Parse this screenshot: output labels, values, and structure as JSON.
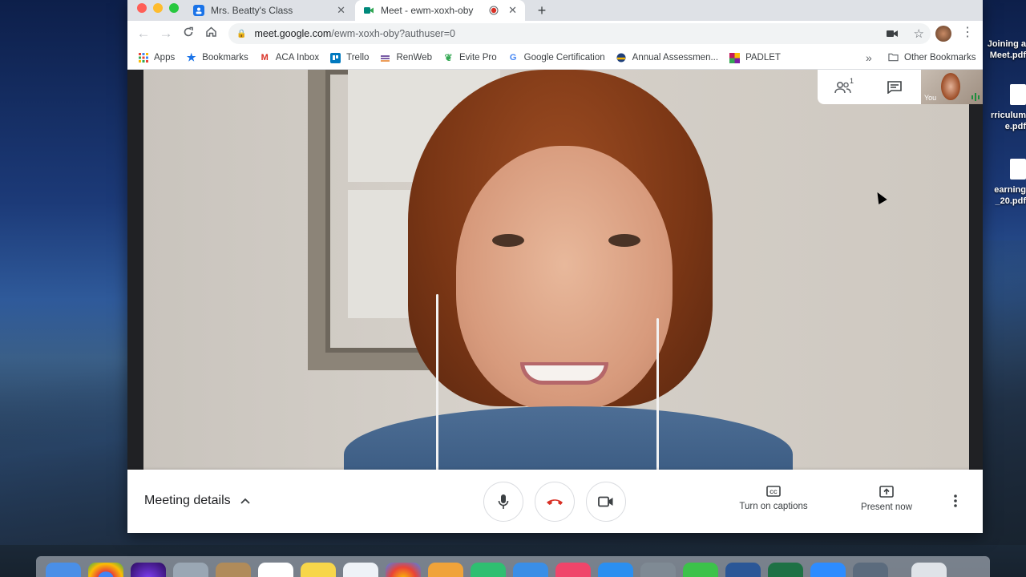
{
  "browser": {
    "tabs": [
      {
        "title": "Mrs. Beatty's Class",
        "active": false
      },
      {
        "title": "Meet - ewm-xoxh-oby",
        "active": true,
        "recording": true
      }
    ],
    "new_tab_symbol": "+",
    "url_host": "meet.google.com",
    "url_path": "/ewm-xoxh-oby?authuser=0",
    "bookmarks": [
      {
        "label": "Apps",
        "icon": "apps-grid-icon",
        "color": "#ea4335"
      },
      {
        "label": "Bookmarks",
        "icon": "star-icon",
        "color": "#1a73e8"
      },
      {
        "label": "ACA Inbox",
        "icon": "gmail-icon",
        "color": "#d93025"
      },
      {
        "label": "Trello",
        "icon": "trello-icon",
        "color": "#0079bf"
      },
      {
        "label": "RenWeb",
        "icon": "renweb-icon",
        "color": "#7b5ea7"
      },
      {
        "label": "Evite Pro",
        "icon": "evite-icon",
        "color": "#34a853"
      },
      {
        "label": "Google Certification",
        "icon": "google-icon",
        "color": "#4285f4"
      },
      {
        "label": "Annual Assessmen...",
        "icon": "assessment-icon",
        "color": "#f4b400"
      },
      {
        "label": "PADLET",
        "icon": "padlet-icon",
        "color": "#c2185b"
      }
    ],
    "overflow_symbol": "»",
    "other_bookmarks": "Other Bookmarks"
  },
  "meet": {
    "participants_count": "1",
    "self_label": "You",
    "meeting_details": "Meeting details",
    "captions_label": "Turn on captions",
    "present_label": "Present now",
    "end_call_color": "#d93025"
  },
  "desktop": {
    "files": [
      {
        "line1": "Joining a",
        "line2": "Meet.pdf"
      },
      {
        "line1": "rriculum",
        "line2": "e.pdf"
      },
      {
        "line1": "earning",
        "line2": "_20.pdf"
      }
    ]
  }
}
